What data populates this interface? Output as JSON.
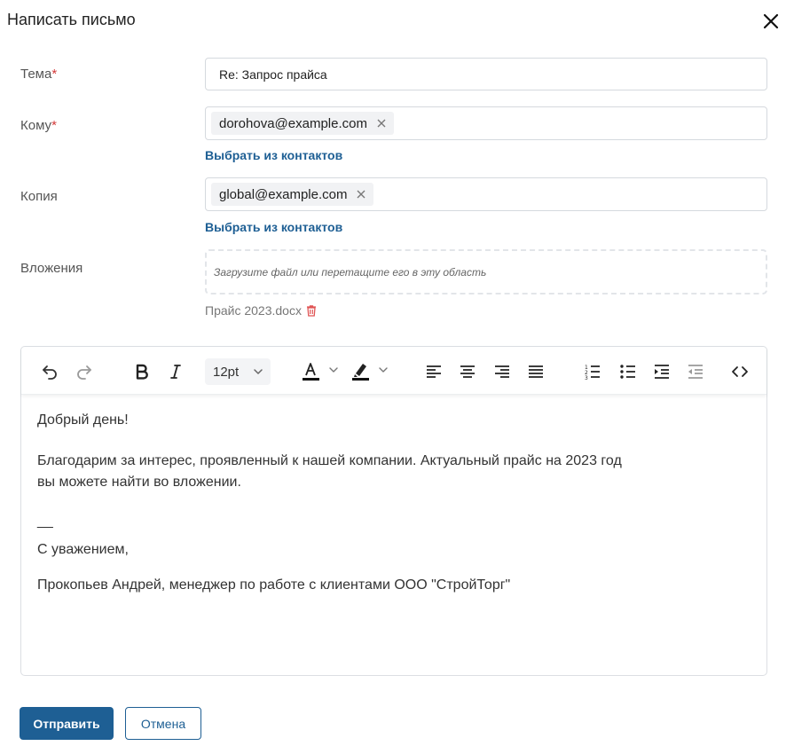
{
  "dialog": {
    "title": "Написать письмо",
    "close_icon": "close-icon"
  },
  "form": {
    "subject": {
      "label": "Тема",
      "required_mark": "*",
      "value": "Re: Запрос прайса"
    },
    "to": {
      "label": "Кому",
      "required_mark": "*",
      "chips": [
        "dorohova@example.com"
      ],
      "pick_link": "Выбрать из контактов"
    },
    "cc": {
      "label": "Копия",
      "chips": [
        "global@example.com"
      ],
      "pick_link": "Выбрать из контактов"
    },
    "attachments": {
      "label": "Вложения",
      "dropzone_text": "Загрузите файл или перетащите его в эту область",
      "files": [
        "Прайс 2023.docx"
      ]
    }
  },
  "editor": {
    "toolbar": {
      "font_size": "12pt",
      "icons": [
        "undo-icon",
        "redo-icon",
        "bold-icon",
        "italic-icon",
        "font-size-select",
        "text-color-icon",
        "highlight-color-icon",
        "align-left-icon",
        "align-center-icon",
        "align-right-icon",
        "align-justify-icon",
        "numbered-list-icon",
        "bullet-list-icon",
        "indent-icon",
        "outdent-icon",
        "source-code-icon"
      ]
    },
    "body": {
      "greeting": "Добрый день!",
      "line1": "Благодарим за интерес, проявленный к нашей компании. Актуальный прайс на 2023 год",
      "line2": "вы можете найти во вложении.",
      "separator": "__",
      "regards": "С уважением,",
      "signature": "Прокопьев Андрей, менеджер по работе с клиентами ООО \"СтройТорг\""
    }
  },
  "actions": {
    "send": "Отправить",
    "cancel": "Отмена"
  },
  "colors": {
    "primary": "#1e5f94",
    "required": "#d33a3a",
    "delete": "#e05555"
  }
}
